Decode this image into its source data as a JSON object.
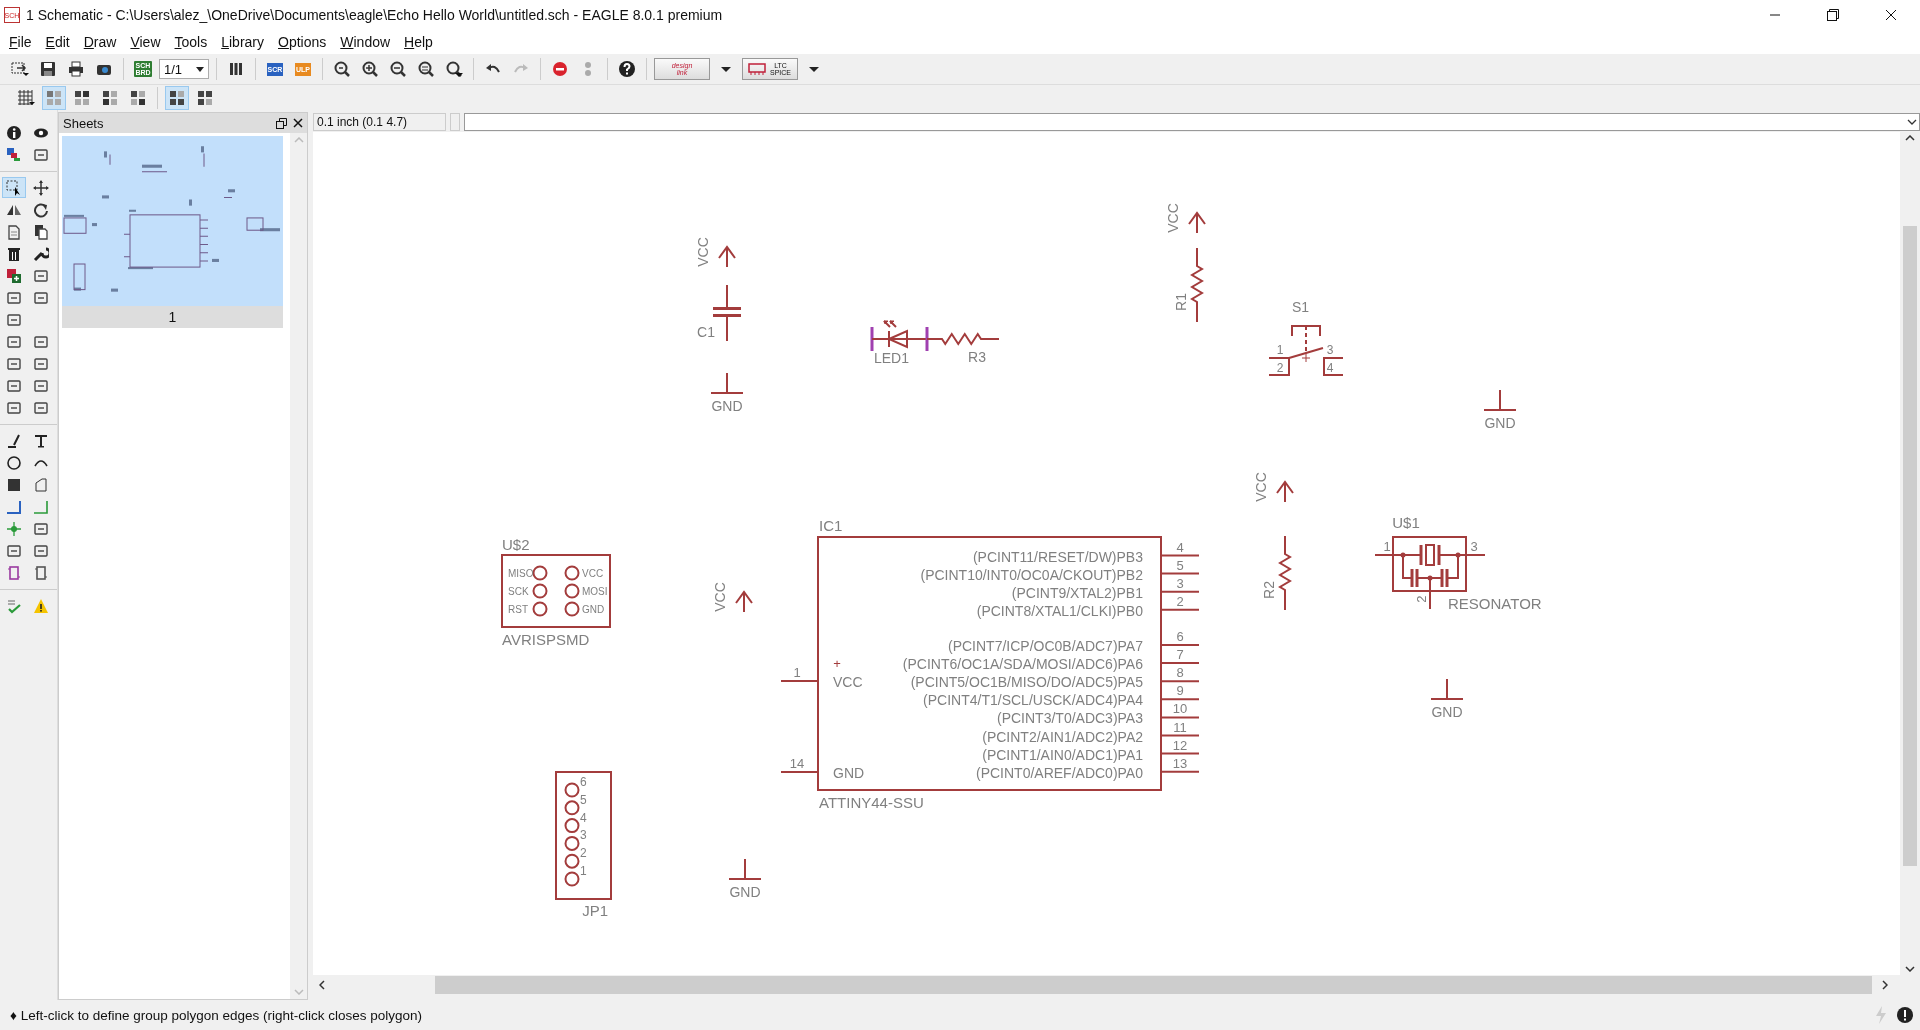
{
  "window": {
    "icon_label": "SCH",
    "title": "1 Schematic - C:\\Users\\alez_\\OneDrive\\Documents\\eagle\\Echo Hello World\\untitled.sch - EAGLE 8.0.1 premium"
  },
  "menu": [
    "File",
    "Edit",
    "Draw",
    "View",
    "Tools",
    "Library",
    "Options",
    "Window",
    "Help"
  ],
  "toolbar": {
    "board_switch": [
      "SCH",
      "BRD"
    ],
    "sheet_combo": "1/1",
    "script_button": "SCR",
    "ulp_button": "ULP",
    "design_link": "design link",
    "spice_button": "LTC SPICE"
  },
  "layout_buttons": [
    {
      "selected": true
    },
    {
      "selected": false
    },
    {
      "selected": false
    },
    {
      "selected": false
    }
  ],
  "panel_buttons": [
    {
      "selected": true
    },
    {
      "selected": false
    }
  ],
  "tools": [
    {
      "selected": false
    },
    {
      "selected": false
    },
    {
      "selected": false
    },
    {
      "selected": false
    },
    {
      "selected": true
    },
    {
      "selected": false
    },
    {
      "selected": false
    },
    {
      "selected": false
    },
    {
      "selected": false
    },
    {
      "selected": false
    },
    {
      "selected": false
    },
    {
      "selected": false
    },
    {
      "selected": false
    },
    {
      "selected": false
    },
    {
      "selected": false
    },
    {
      "selected": false
    },
    {
      "selected": false
    },
    {
      "selected": false
    },
    {
      "selected": false
    },
    {
      "selected": false
    },
    {
      "selected": false
    },
    {
      "selected": false
    },
    {
      "selected": false
    },
    {
      "selected": false
    },
    {
      "selected": false
    },
    {
      "selected": false
    },
    {
      "selected": false
    },
    {
      "selected": false
    },
    {
      "selected": false
    },
    {
      "selected": false
    },
    {
      "selected": false
    },
    {
      "selected": false
    },
    {
      "selected": false
    },
    {
      "selected": false
    },
    {
      "selected": false
    },
    {
      "selected": false
    },
    {
      "selected": false
    },
    {
      "selected": false
    },
    {
      "selected": false
    },
    {
      "selected": false
    },
    {
      "selected": false
    }
  ],
  "sheets_panel": {
    "title": "Sheets",
    "sheets": [
      {
        "label": "1",
        "selected": true
      }
    ]
  },
  "coordinates": "0.1 inch (0.1 4.7)",
  "schematic": [
    {
      "kind": "supply",
      "label": "VCC"
    },
    {
      "kind": "capacitor",
      "name": "C1"
    },
    {
      "kind": "ground",
      "label": "GND"
    },
    {
      "kind": "led",
      "name": "LED1"
    },
    {
      "kind": "resistor",
      "name": "R3"
    },
    {
      "kind": "supply",
      "label": "VCC"
    },
    {
      "kind": "resistor",
      "name": "R1"
    },
    {
      "kind": "switch",
      "name": "S1",
      "pins": [
        "1",
        "2",
        "3",
        "4"
      ]
    },
    {
      "kind": "ground",
      "label": "GND"
    },
    {
      "kind": "supply",
      "label": "VCC"
    },
    {
      "kind": "resistor",
      "name": "R2"
    },
    {
      "kind": "resonator",
      "name": "U$1",
      "value": "RESONATOR",
      "pins": [
        "1",
        "2",
        "3"
      ]
    },
    {
      "kind": "ground",
      "label": "GND"
    },
    {
      "kind": "isp_header",
      "name": "U$2",
      "value": "AVRISPSMD",
      "pins": [
        "MISO",
        "SCK",
        "RST",
        "VCC",
        "MOSI",
        "GND"
      ]
    },
    {
      "kind": "supply",
      "label": "VCC"
    },
    {
      "kind": "ic",
      "name": "IC1",
      "value": "ATTINY44-SSU",
      "supply_mark": "+",
      "left_pins": [
        {
          "number": "1",
          "name": "VCC"
        },
        {
          "number": "14",
          "name": "GND"
        }
      ],
      "right_pin_groups": [
        [
          {
            "number": "4",
            "name": "(PCINT11/RESET/DW)PB3"
          },
          {
            "number": "5",
            "name": "(PCINT10/INT0/OC0A/CKOUT)PB2"
          },
          {
            "number": "3",
            "name": "(PCINT9/XTAL2)PB1"
          },
          {
            "number": "2",
            "name": "(PCINT8/XTAL1/CLKI)PB0"
          }
        ],
        [
          {
            "number": "6",
            "name": "(PCINT7/ICP/OC0B/ADC7)PA7"
          },
          {
            "number": "7",
            "name": "(PCINT6/OC1A/SDA/MOSI/ADC6)PA6"
          },
          {
            "number": "8",
            "name": "(PCINT5/OC1B/MISO/DO/ADC5)PA5"
          },
          {
            "number": "9",
            "name": "(PCINT4/T1/SCL/USCK/ADC4)PA4"
          },
          {
            "number": "10",
            "name": "(PCINT3/T0/ADC3)PA3"
          },
          {
            "number": "11",
            "name": "(PCINT2/AIN1/ADC2)PA2"
          },
          {
            "number": "12",
            "name": "(PCINT1/AIN0/ADC1)PA1"
          },
          {
            "number": "13",
            "name": "(PCINT0/AREF/ADC0)PA0"
          }
        ]
      ]
    },
    {
      "kind": "pin_header",
      "name": "JP1",
      "pins": [
        "6",
        "5",
        "4",
        "3",
        "2",
        "1"
      ]
    },
    {
      "kind": "ground",
      "label": "GND"
    }
  ],
  "status_bar": {
    "message": "♦ Left-click to define group polygon edges (right-click closes polygon)"
  }
}
